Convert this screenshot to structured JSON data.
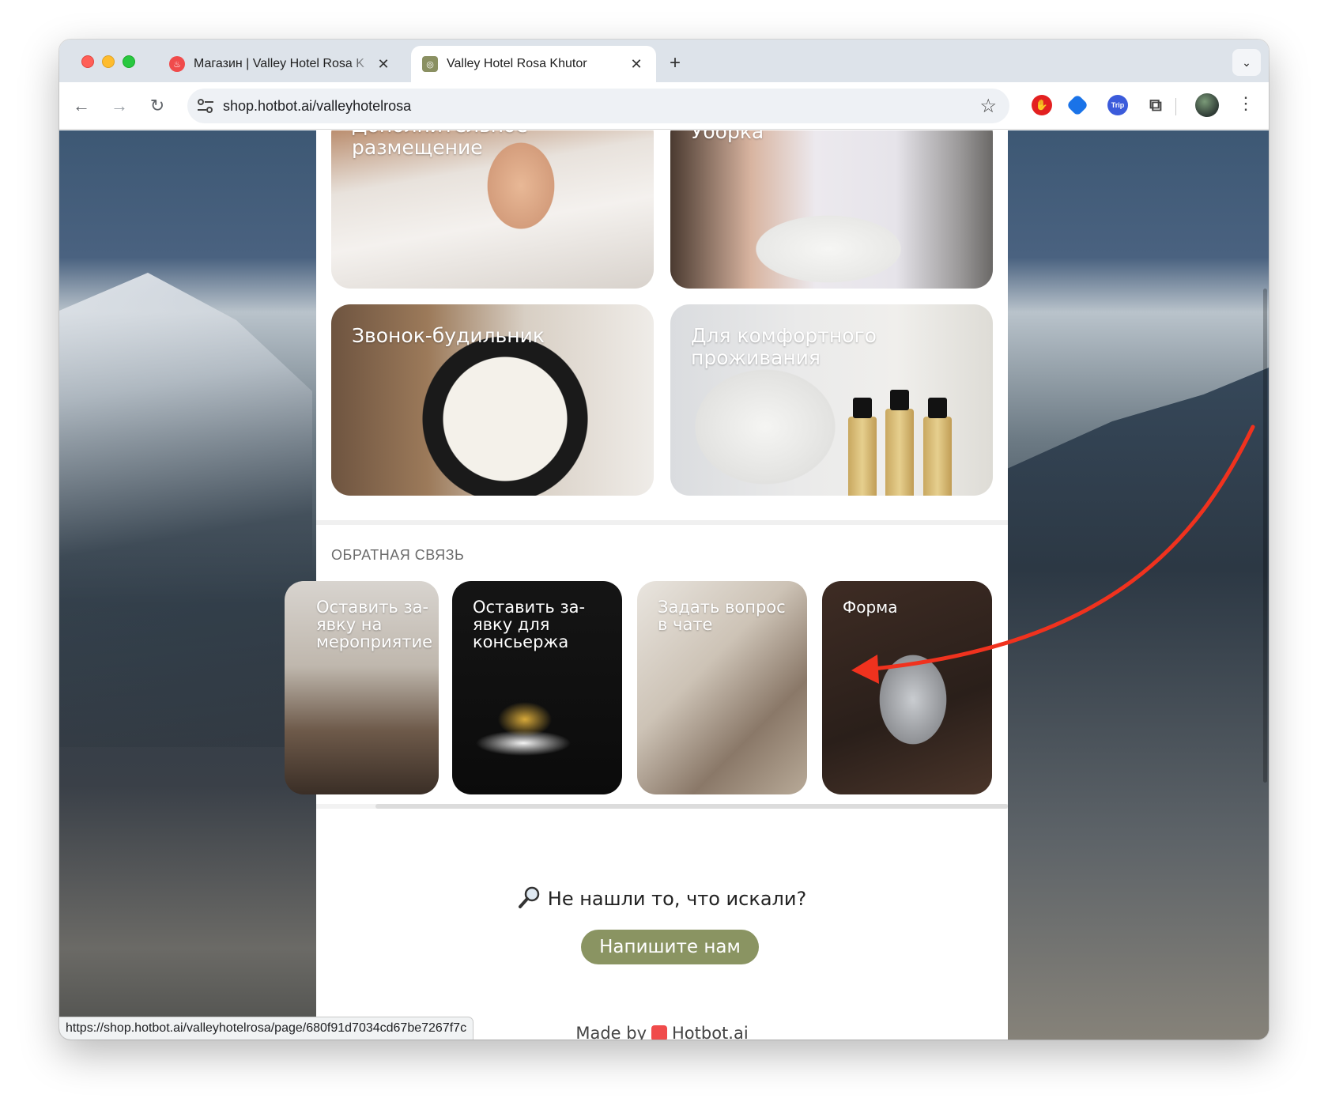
{
  "browser": {
    "tabs": [
      {
        "title": "Магазин | Valley Hotel Rosa K",
        "active": false
      },
      {
        "title": "Valley Hotel Rosa Khutor",
        "active": true
      }
    ],
    "url": "shop.hotbot.ai/valleyhotelrosa",
    "extension_labels": {
      "trip": "Trip"
    },
    "status_url": "https://shop.hotbot.ai/valleyhotelrosa/page/680f91d7034cd67be7267f7c"
  },
  "services": {
    "cards": [
      {
        "title": "Дополнительное\nразмещение"
      },
      {
        "title": "Уборка"
      },
      {
        "title": "Звонок-будильник"
      },
      {
        "title": "Для комфортного\nпроживания"
      }
    ]
  },
  "feedback": {
    "section_label": "ОБРАТНАЯ СВЯЗЬ",
    "cards": [
      {
        "title": "Оставить за-\nявку на\nмероприятие"
      },
      {
        "title": "Оставить за-\nявку для\nконсьержа"
      },
      {
        "title": "Задать вопрос\nв чате"
      },
      {
        "title": "Форма"
      }
    ]
  },
  "footer": {
    "not_found": "Не нашли то, что искали?",
    "cta": "Напишите нам",
    "made_by": "Made by",
    "brand": "Hotbot.ai"
  },
  "colors": {
    "accent_olive": "#8a9462",
    "annotation_arrow": "#f0321e"
  }
}
